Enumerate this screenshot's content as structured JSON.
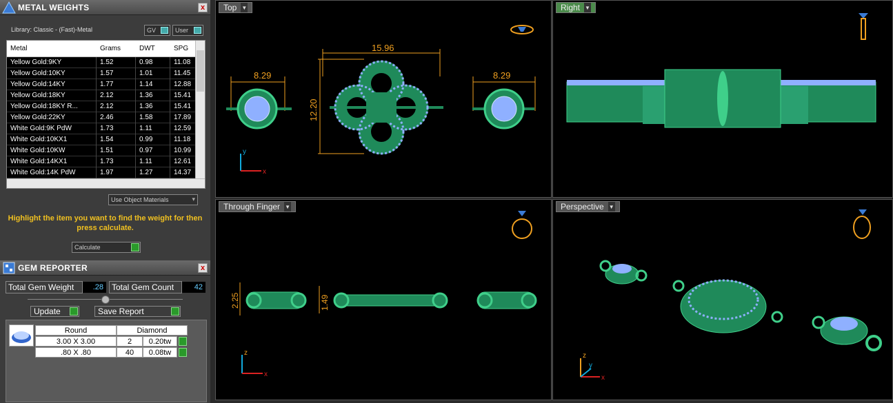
{
  "metal_weights": {
    "title": "METAL WEIGHTS",
    "close": "x",
    "library": "Library: Classic - (Fast)-Metal",
    "toggle_gv": "GV",
    "toggle_user": "User",
    "columns": [
      "Metal",
      "Grams",
      "DWT",
      "SPG"
    ],
    "rows": [
      [
        "Yellow Gold:9KY",
        "1.52",
        "0.98",
        "11.08"
      ],
      [
        "Yellow Gold:10KY",
        "1.57",
        "1.01",
        "11.45"
      ],
      [
        "Yellow Gold:14KY",
        "1.77",
        "1.14",
        "12.88"
      ],
      [
        "Yellow Gold:18KY",
        "2.12",
        "1.36",
        "15.41"
      ],
      [
        "Yellow Gold:18KY R...",
        "2.12",
        "1.36",
        "15.41"
      ],
      [
        "Yellow Gold:22KY",
        "2.46",
        "1.58",
        "17.89"
      ],
      [
        "White Gold:9K PdW",
        "1.73",
        "1.11",
        "12.59"
      ],
      [
        "White Gold:10KX1",
        "1.54",
        "0.99",
        "11.18"
      ],
      [
        "White Gold:10KW",
        "1.51",
        "0.97",
        "10.99"
      ],
      [
        "White Gold:14KX1",
        "1.73",
        "1.11",
        "12.61"
      ],
      [
        "White Gold:14K PdW",
        "1.97",
        "1.27",
        "14.37"
      ]
    ],
    "use_object_materials": "Use Object Materials",
    "hint": "Highlight the item you want to find the weight for then press calculate.",
    "calculate": "Calculate"
  },
  "gem_reporter": {
    "title": "GEM REPORTER",
    "close": "x",
    "total_weight_label": "Total Gem Weight",
    "total_weight": ".28",
    "total_count_label": "Total Gem Count",
    "total_count": "42",
    "update": "Update",
    "save_report": "Save Report",
    "shape": "Round",
    "stone": "Diamond",
    "rows": [
      {
        "size": "3.00 X 3.00",
        "count": "2",
        "tw": "0.20tw"
      },
      {
        "size": ".80 X .80",
        "count": "40",
        "tw": "0.08tw"
      }
    ]
  },
  "viewports": {
    "top": {
      "label": "Top",
      "dim_left": "8.29",
      "dim_center": "15.96",
      "dim_right": "8.29",
      "dim_vertical": "12.20"
    },
    "right": {
      "label": "Right"
    },
    "through": {
      "label": "Through Finger",
      "dim_a": "2.25",
      "dim_b": "1.49"
    },
    "perspective": {
      "label": "Perspective"
    },
    "axis_x": "x",
    "axis_y": "y",
    "axis_z": "z"
  },
  "colors": {
    "metal": "#1f8a5a",
    "metal_light": "#3fcf8a",
    "gem": "#8fb0ff",
    "dim": "#f0a020"
  }
}
